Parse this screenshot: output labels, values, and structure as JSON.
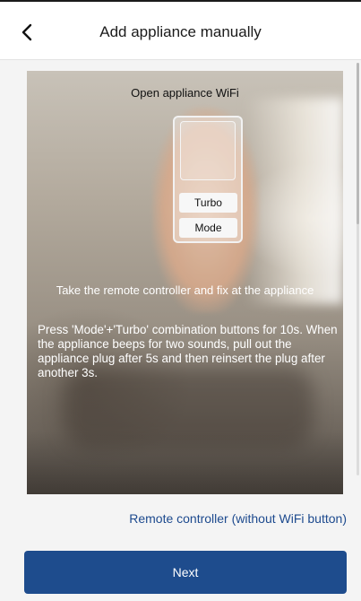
{
  "header": {
    "title": "Add appliance manually",
    "back_icon": "chevron-left-icon"
  },
  "illustration": {
    "title": "Open appliance WiFi",
    "remote_buttons": [
      "Turbo",
      "Mode"
    ],
    "caption": "Take the remote controller and fix at the appliance",
    "instructions": "Press 'Mode'+'Turbo' combination buttons for 10s. When the appliance beeps for two sounds, pull out the appliance plug after 5s and then reinsert the plug after another 3s."
  },
  "alt_link": "Remote controller (without WiFi button)",
  "primary_button": "Next",
  "colors": {
    "accent": "#1e4c8d",
    "link": "#1d4a8e",
    "background": "#f4f4f4"
  }
}
